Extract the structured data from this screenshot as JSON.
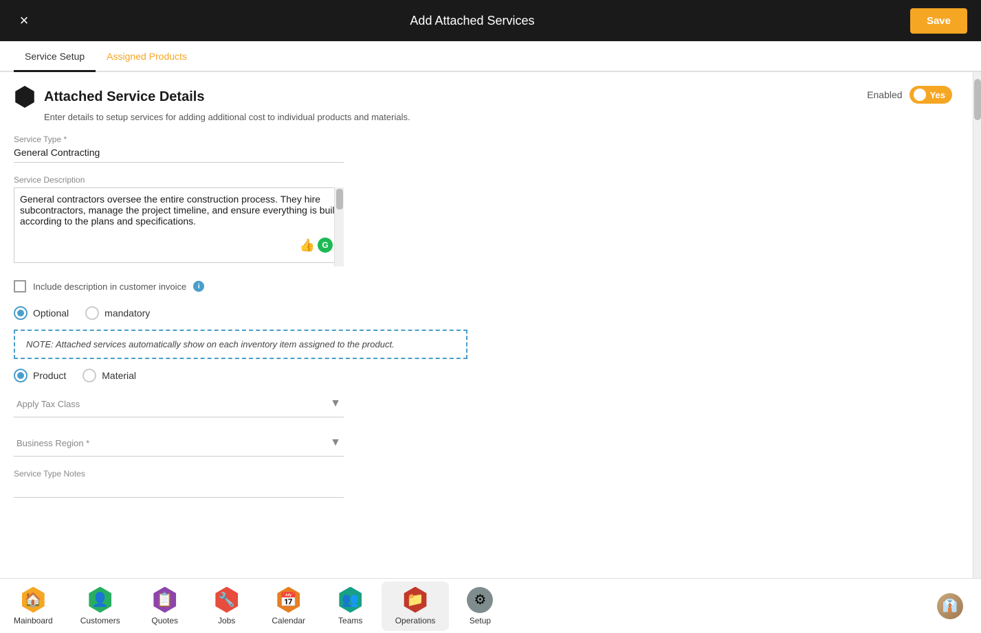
{
  "header": {
    "title": "Add Attached Services",
    "close_label": "×",
    "save_label": "Save"
  },
  "tabs": [
    {
      "id": "service-setup",
      "label": "Service Setup",
      "active": true
    },
    {
      "id": "assigned-products",
      "label": "Assigned Products",
      "active": false,
      "orange": true
    }
  ],
  "section": {
    "title": "Attached Service Details",
    "subtitle": "Enter details to setup services for adding additional cost to individual products and materials.",
    "enabled_label": "Enabled",
    "toggle_label": "Yes"
  },
  "fields": {
    "service_type": {
      "label": "Service Type *",
      "value": "General Contracting"
    },
    "service_description": {
      "label": "Service Description",
      "value": "General contractors oversee the entire construction process. They hire subcontractors, manage the project timeline, and ensure everything is built according to the plans and specifications."
    },
    "include_description": {
      "label": "Include description in customer invoice"
    },
    "optional_mandatory": {
      "options": [
        "Optional",
        "mandatory"
      ],
      "selected": "Optional"
    },
    "note": {
      "text": "NOTE: Attached services automatically show on each inventory item assigned to the product."
    },
    "product_material": {
      "options": [
        "Product",
        "Material"
      ],
      "selected": "Product"
    },
    "apply_tax_class": {
      "label": "Apply Tax Class"
    },
    "business_region": {
      "label": "Business Region *"
    },
    "service_type_notes": {
      "label": "Service Type Notes"
    }
  },
  "bottom_nav": {
    "items": [
      {
        "id": "mainboard",
        "label": "Mainboard",
        "icon": "⊞",
        "color": "yellow"
      },
      {
        "id": "customers",
        "label": "Customers",
        "icon": "👤",
        "color": "green"
      },
      {
        "id": "quotes",
        "label": "Quotes",
        "icon": "📋",
        "color": "purple"
      },
      {
        "id": "jobs",
        "label": "Jobs",
        "icon": "🔧",
        "color": "red"
      },
      {
        "id": "calendar",
        "label": "Calendar",
        "icon": "📅",
        "color": "orange"
      },
      {
        "id": "teams",
        "label": "Teams",
        "icon": "👥",
        "color": "teal"
      },
      {
        "id": "operations",
        "label": "Operations",
        "icon": "📁",
        "color": "dark-red",
        "active": true
      },
      {
        "id": "setup",
        "label": "Setup",
        "icon": "⚙",
        "color": "gray-dark"
      }
    ]
  }
}
